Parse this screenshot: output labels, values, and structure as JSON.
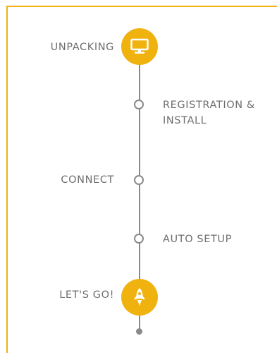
{
  "steps": [
    {
      "label": "UNPACKING",
      "side": "left",
      "icon": "monitor-icon",
      "type": "big"
    },
    {
      "label": "REGISTRATION & INSTALL",
      "side": "right",
      "type": "small"
    },
    {
      "label": "CONNECT",
      "side": "left",
      "type": "small"
    },
    {
      "label": "AUTO SETUP",
      "side": "right",
      "type": "small"
    },
    {
      "label": "LET'S GO!",
      "side": "left",
      "icon": "rocket-icon",
      "type": "big"
    }
  ],
  "colors": {
    "accent": "#F0B20E",
    "line": "#8a8a8a",
    "text": "#6e6e6e"
  }
}
